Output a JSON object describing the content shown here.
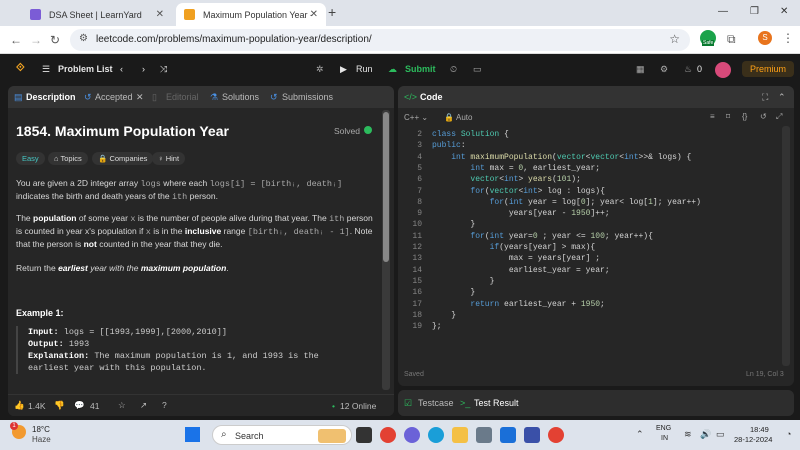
{
  "browser": {
    "tabs": [
      {
        "label": "DSA Sheet | LearnYard"
      },
      {
        "label": "Maximum Population Year - Lee"
      }
    ],
    "url": "leetcode.com/problems/maximum-population-year/description/",
    "profile_initial": "S",
    "safe_badge": "Safe"
  },
  "lc_header": {
    "problem_list": "Problem List",
    "run": "Run",
    "submit": "Submit",
    "streak": "0",
    "premium": "Premium"
  },
  "left_tabs": {
    "description": "Description",
    "accepted": "Accepted",
    "editorial": "Editorial",
    "solutions": "Solutions",
    "submissions": "Submissions"
  },
  "problem": {
    "title": "1854. Maximum Population Year",
    "status": "Solved",
    "difficulty": "Easy",
    "topics": "Topics",
    "companies": "Companies",
    "hint": "Hint",
    "para1_a": "You are given a 2D integer array",
    "para1_code1": "logs",
    "para1_b": "where each",
    "para1_code2": "logs[i] = [birthᵢ, deathᵢ]",
    "para1_c": "indicates the birth and death years of the",
    "para1_sup": "ith",
    "para1_d": "person.",
    "para2_a": "The",
    "para2_bold": "population",
    "para2_b": "of some year",
    "para2_code": "x",
    "para2_c": "is the number of people alive during that year. The",
    "para2_sup": "ith",
    "para2_d": "person is counted in year",
    "para2_e": "x's population if",
    "para2_code2": "x",
    "para2_f": "is in the",
    "para2_bold2": "inclusive",
    "para2_g": "range",
    "para2_code3": "[birthᵢ, deathᵢ - 1]",
    "para2_h": ". Note that the person is",
    "para2_bold3": "not",
    "para2_i": "counted in the year that they die.",
    "para3_a": "Return the",
    "para3_em": "earliest",
    "para3_b": "year with the",
    "para3_em2": "maximum population",
    "para3_c": ".",
    "example_title": "Example 1:",
    "example_input_label": "Input:",
    "example_input": "logs = [[1993,1999],[2000,2010]]",
    "example_output_label": "Output:",
    "example_output": "1993",
    "example_expl_label": "Explanation:",
    "example_expl": "The maximum population is 1, and 1993 is the earliest year with this population."
  },
  "left_footer": {
    "likes": "1.4K",
    "comments": "41",
    "online": "12 Online"
  },
  "code_panel": {
    "title": "Code",
    "language": "C++",
    "auto": "Auto",
    "saved": "Saved",
    "cursor": "Ln 19, Col 3",
    "lines": [
      "class Solution {",
      "public:",
      "    int maximumPopulation(vector<vector<int>>& logs) {",
      "        int max = 0, earliest_year;",
      "        vector<int> years(101);",
      "        for(vector<int> log : logs){",
      "            for(int year = log[0]; year< log[1]; year++)",
      "                years[year - 1950]++;",
      "        }",
      "        for(int year=0 ; year <= 100; year++){",
      "            if(years[year] > max){",
      "                max = years[year] ;",
      "                earliest_year = year;",
      "            }",
      "        }",
      "        return earliest_year + 1950;",
      "    }",
      "};"
    ],
    "line_numbers": [
      "2",
      "3",
      "4",
      "5",
      "6",
      "7",
      "8",
      "9",
      "10",
      "11",
      "12",
      "13",
      "14",
      "15",
      "16",
      "17",
      "18",
      "19"
    ]
  },
  "bottom_tabs": {
    "testcase": "Testcase",
    "test_result": "Test Result"
  },
  "taskbar": {
    "weather_temp": "18°C",
    "weather_desc": "Haze",
    "search": "Search",
    "lang": "ENG",
    "region": "IN",
    "time": "18:49",
    "date": "28-12-2024",
    "notification_badge": "1"
  }
}
